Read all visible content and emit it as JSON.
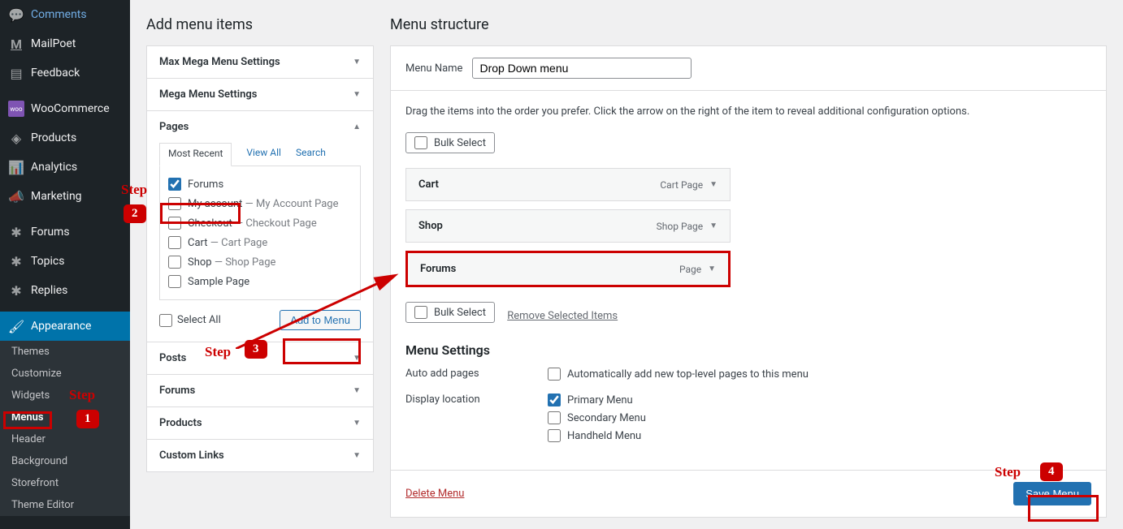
{
  "sidebar": {
    "items": [
      {
        "label": "Comments",
        "icon": "💬"
      },
      {
        "label": "MailPoet",
        "icon": "M"
      },
      {
        "label": "Feedback",
        "icon": "☰"
      },
      {
        "label": "WooCommerce",
        "icon": "woo"
      },
      {
        "label": "Products",
        "icon": "📦"
      },
      {
        "label": "Analytics",
        "icon": "📊"
      },
      {
        "label": "Marketing",
        "icon": "📢"
      },
      {
        "label": "Forums",
        "icon": "✱"
      },
      {
        "label": "Topics",
        "icon": "✱"
      },
      {
        "label": "Replies",
        "icon": "✱"
      },
      {
        "label": "Appearance",
        "icon": "🖌"
      }
    ],
    "submenu": [
      {
        "label": "Themes"
      },
      {
        "label": "Customize"
      },
      {
        "label": "Widgets"
      },
      {
        "label": "Menus"
      },
      {
        "label": "Header"
      },
      {
        "label": "Background"
      },
      {
        "label": "Storefront"
      },
      {
        "label": "Theme Editor"
      }
    ]
  },
  "left": {
    "title": "Add menu items",
    "panels": [
      {
        "label": "Max Mega Menu Settings"
      },
      {
        "label": "Mega Menu Settings"
      },
      {
        "label": "Pages"
      },
      {
        "label": "Posts"
      },
      {
        "label": "Forums"
      },
      {
        "label": "Products"
      },
      {
        "label": "Custom Links"
      }
    ],
    "tabs": [
      {
        "label": "Most Recent"
      },
      {
        "label": "View All"
      },
      {
        "label": "Search"
      }
    ],
    "pages": [
      {
        "label": "Forums",
        "suffix": ""
      },
      {
        "label": "My account",
        "suffix": "My Account Page"
      },
      {
        "label": "Checkout",
        "suffix": "Checkout Page"
      },
      {
        "label": "Cart",
        "suffix": "Cart Page"
      },
      {
        "label": "Shop",
        "suffix": "Shop Page"
      },
      {
        "label": "Sample Page",
        "suffix": ""
      }
    ],
    "select_all": "Select All",
    "add_to_menu": "Add to Menu"
  },
  "right": {
    "title": "Menu structure",
    "menu_name_label": "Menu Name",
    "menu_name_value": "Drop Down menu",
    "instructions": "Drag the items into the order you prefer. Click the arrow on the right of the item to reveal additional configuration options.",
    "bulk_select": "Bulk Select",
    "remove_selected": "Remove Selected Items",
    "menu_items": [
      {
        "title": "Cart",
        "type": "Cart Page"
      },
      {
        "title": "Shop",
        "type": "Shop Page"
      },
      {
        "title": "Forums",
        "type": "Page"
      }
    ],
    "settings_title": "Menu Settings",
    "auto_add_label": "Auto add pages",
    "auto_add_option": "Automatically add new top-level pages to this menu",
    "display_label": "Display location",
    "display_options": [
      {
        "label": "Primary Menu"
      },
      {
        "label": "Secondary Menu"
      },
      {
        "label": "Handheld Menu"
      }
    ],
    "delete_menu": "Delete Menu",
    "save_menu": "Save Menu"
  },
  "annotations": {
    "step": "Step"
  }
}
